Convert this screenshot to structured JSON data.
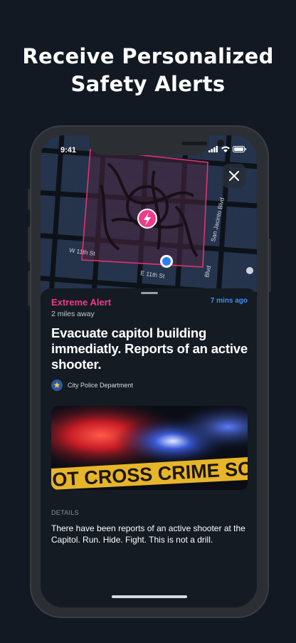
{
  "headline": {
    "line1": "Receive Personalized",
    "line2": "Safety Alerts"
  },
  "status_bar": {
    "time": "9:41",
    "icons": [
      "signal-icon",
      "wifi-icon",
      "battery-icon"
    ]
  },
  "map": {
    "streets": [
      "W 11th St",
      "E 11th St",
      "San Jacinto Blvd",
      "Blvd"
    ],
    "alert_marker_icon": "lightning-icon",
    "user_location_icon": "location-dot-icon",
    "zone_color": "#e0336f"
  },
  "alert": {
    "type": "Extreme Alert",
    "time_ago": "7 mins ago",
    "distance": "2 miles away",
    "title": "Evacuate capitol building immediatly. Reports of an active shooter.",
    "source": "City Police Department",
    "photo_tape_text": "OT CROSS   CRIME SCEN",
    "details_label": "DETAILS",
    "details_text": "There have been reports of an active shooter at the Capitol. Run. Hide. Fight. This is not a drill."
  },
  "colors": {
    "background": "#121922",
    "accent_pink": "#f03a8a",
    "accent_blue": "#3f8ff0"
  }
}
